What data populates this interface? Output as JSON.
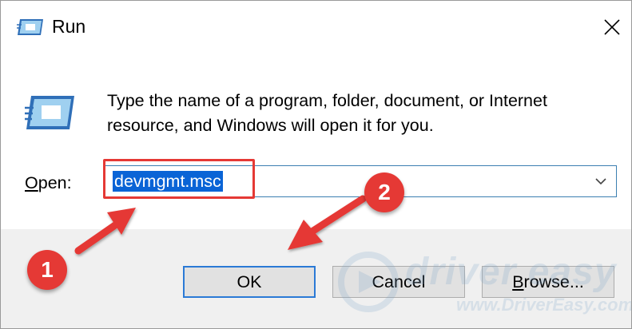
{
  "window": {
    "title": "Run",
    "close_glyph": "✕"
  },
  "body": {
    "description": "Type the name of a program, folder, document, or Internet resource, and Windows will open it for you.",
    "open_label_accel": "O",
    "open_label_rest": "pen:",
    "open_value": "devmgmt.msc"
  },
  "buttons": {
    "ok": "OK",
    "cancel": "Cancel",
    "browse_accel": "B",
    "browse_rest": "rowse..."
  },
  "annotations": {
    "step1": "1",
    "step2": "2",
    "highlight_color": "#e53935"
  },
  "watermark": {
    "main": "driver easy",
    "sub": "www.DriverEasy.com"
  },
  "icons": [
    "run-icon",
    "close-icon",
    "chevron-down-icon",
    "logo-icon"
  ]
}
